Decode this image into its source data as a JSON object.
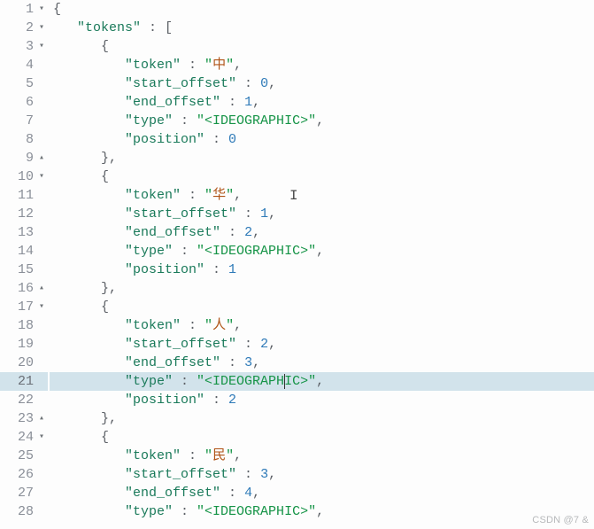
{
  "watermark": "CSDN @7 &",
  "highlighted_line": 21,
  "ibeam": {
    "line": 11,
    "text_before": "      \"token\" : \"华\",      "
  },
  "caret_line21_text_before": "      \"type\" : \"<IDEOGRAPH",
  "gutter": [
    {
      "n": "1",
      "fold": "down"
    },
    {
      "n": "2",
      "fold": "down"
    },
    {
      "n": "3",
      "fold": "down"
    },
    {
      "n": "4",
      "fold": ""
    },
    {
      "n": "5",
      "fold": ""
    },
    {
      "n": "6",
      "fold": ""
    },
    {
      "n": "7",
      "fold": ""
    },
    {
      "n": "8",
      "fold": ""
    },
    {
      "n": "9",
      "fold": "up"
    },
    {
      "n": "10",
      "fold": "down"
    },
    {
      "n": "11",
      "fold": ""
    },
    {
      "n": "12",
      "fold": ""
    },
    {
      "n": "13",
      "fold": ""
    },
    {
      "n": "14",
      "fold": ""
    },
    {
      "n": "15",
      "fold": ""
    },
    {
      "n": "16",
      "fold": "up"
    },
    {
      "n": "17",
      "fold": "down"
    },
    {
      "n": "18",
      "fold": ""
    },
    {
      "n": "19",
      "fold": ""
    },
    {
      "n": "20",
      "fold": ""
    },
    {
      "n": "21",
      "fold": ""
    },
    {
      "n": "22",
      "fold": ""
    },
    {
      "n": "23",
      "fold": "up"
    },
    {
      "n": "24",
      "fold": "down"
    },
    {
      "n": "25",
      "fold": ""
    },
    {
      "n": "26",
      "fold": ""
    },
    {
      "n": "27",
      "fold": ""
    },
    {
      "n": "28",
      "fold": ""
    }
  ],
  "lines": [
    {
      "i": 0,
      "t": [
        {
          "c": "p",
          "x": "{"
        }
      ]
    },
    {
      "i": 1,
      "t": [
        {
          "c": "k",
          "x": "\"tokens\""
        },
        {
          "c": "p",
          "x": " : ["
        }
      ]
    },
    {
      "i": 2,
      "t": [
        {
          "c": "p",
          "x": "{"
        }
      ]
    },
    {
      "i": 3,
      "t": [
        {
          "c": "k",
          "x": "\"token\""
        },
        {
          "c": "p",
          "x": " : "
        },
        {
          "c": "s",
          "x": "\""
        },
        {
          "c": "cj",
          "x": "中"
        },
        {
          "c": "s",
          "x": "\""
        },
        {
          "c": "p",
          "x": ","
        }
      ]
    },
    {
      "i": 3,
      "t": [
        {
          "c": "k",
          "x": "\"start_offset\""
        },
        {
          "c": "p",
          "x": " : "
        },
        {
          "c": "n",
          "x": "0"
        },
        {
          "c": "p",
          "x": ","
        }
      ]
    },
    {
      "i": 3,
      "t": [
        {
          "c": "k",
          "x": "\"end_offset\""
        },
        {
          "c": "p",
          "x": " : "
        },
        {
          "c": "n",
          "x": "1"
        },
        {
          "c": "p",
          "x": ","
        }
      ]
    },
    {
      "i": 3,
      "t": [
        {
          "c": "k",
          "x": "\"type\""
        },
        {
          "c": "p",
          "x": " : "
        },
        {
          "c": "s",
          "x": "\"<IDEOGRAPHIC>\""
        },
        {
          "c": "p",
          "x": ","
        }
      ]
    },
    {
      "i": 3,
      "t": [
        {
          "c": "k",
          "x": "\"position\""
        },
        {
          "c": "p",
          "x": " : "
        },
        {
          "c": "n",
          "x": "0"
        }
      ]
    },
    {
      "i": 2,
      "t": [
        {
          "c": "p",
          "x": "},"
        }
      ]
    },
    {
      "i": 2,
      "t": [
        {
          "c": "p",
          "x": "{"
        }
      ]
    },
    {
      "i": 3,
      "t": [
        {
          "c": "k",
          "x": "\"token\""
        },
        {
          "c": "p",
          "x": " : "
        },
        {
          "c": "s",
          "x": "\""
        },
        {
          "c": "cj",
          "x": "华"
        },
        {
          "c": "s",
          "x": "\""
        },
        {
          "c": "p",
          "x": ","
        }
      ]
    },
    {
      "i": 3,
      "t": [
        {
          "c": "k",
          "x": "\"start_offset\""
        },
        {
          "c": "p",
          "x": " : "
        },
        {
          "c": "n",
          "x": "1"
        },
        {
          "c": "p",
          "x": ","
        }
      ]
    },
    {
      "i": 3,
      "t": [
        {
          "c": "k",
          "x": "\"end_offset\""
        },
        {
          "c": "p",
          "x": " : "
        },
        {
          "c": "n",
          "x": "2"
        },
        {
          "c": "p",
          "x": ","
        }
      ]
    },
    {
      "i": 3,
      "t": [
        {
          "c": "k",
          "x": "\"type\""
        },
        {
          "c": "p",
          "x": " : "
        },
        {
          "c": "s",
          "x": "\"<IDEOGRAPHIC>\""
        },
        {
          "c": "p",
          "x": ","
        }
      ]
    },
    {
      "i": 3,
      "t": [
        {
          "c": "k",
          "x": "\"position\""
        },
        {
          "c": "p",
          "x": " : "
        },
        {
          "c": "n",
          "x": "1"
        }
      ]
    },
    {
      "i": 2,
      "t": [
        {
          "c": "p",
          "x": "},"
        }
      ]
    },
    {
      "i": 2,
      "t": [
        {
          "c": "p",
          "x": "{"
        }
      ]
    },
    {
      "i": 3,
      "t": [
        {
          "c": "k",
          "x": "\"token\""
        },
        {
          "c": "p",
          "x": " : "
        },
        {
          "c": "s",
          "x": "\""
        },
        {
          "c": "cj",
          "x": "人"
        },
        {
          "c": "s",
          "x": "\""
        },
        {
          "c": "p",
          "x": ","
        }
      ]
    },
    {
      "i": 3,
      "t": [
        {
          "c": "k",
          "x": "\"start_offset\""
        },
        {
          "c": "p",
          "x": " : "
        },
        {
          "c": "n",
          "x": "2"
        },
        {
          "c": "p",
          "x": ","
        }
      ]
    },
    {
      "i": 3,
      "t": [
        {
          "c": "k",
          "x": "\"end_offset\""
        },
        {
          "c": "p",
          "x": " : "
        },
        {
          "c": "n",
          "x": "3"
        },
        {
          "c": "p",
          "x": ","
        }
      ]
    },
    {
      "i": 3,
      "t": [
        {
          "c": "k",
          "x": "\"type\""
        },
        {
          "c": "p",
          "x": " : "
        },
        {
          "c": "s",
          "x": "\"<IDEOGRAPHIC>\""
        },
        {
          "c": "p",
          "x": ","
        }
      ]
    },
    {
      "i": 3,
      "t": [
        {
          "c": "k",
          "x": "\"position\""
        },
        {
          "c": "p",
          "x": " : "
        },
        {
          "c": "n",
          "x": "2"
        }
      ]
    },
    {
      "i": 2,
      "t": [
        {
          "c": "p",
          "x": "},"
        }
      ]
    },
    {
      "i": 2,
      "t": [
        {
          "c": "p",
          "x": "{"
        }
      ]
    },
    {
      "i": 3,
      "t": [
        {
          "c": "k",
          "x": "\"token\""
        },
        {
          "c": "p",
          "x": " : "
        },
        {
          "c": "s",
          "x": "\""
        },
        {
          "c": "cj",
          "x": "民"
        },
        {
          "c": "s",
          "x": "\""
        },
        {
          "c": "p",
          "x": ","
        }
      ]
    },
    {
      "i": 3,
      "t": [
        {
          "c": "k",
          "x": "\"start_offset\""
        },
        {
          "c": "p",
          "x": " : "
        },
        {
          "c": "n",
          "x": "3"
        },
        {
          "c": "p",
          "x": ","
        }
      ]
    },
    {
      "i": 3,
      "t": [
        {
          "c": "k",
          "x": "\"end_offset\""
        },
        {
          "c": "p",
          "x": " : "
        },
        {
          "c": "n",
          "x": "4"
        },
        {
          "c": "p",
          "x": ","
        }
      ]
    },
    {
      "i": 3,
      "t": [
        {
          "c": "k",
          "x": "\"type\""
        },
        {
          "c": "p",
          "x": " : "
        },
        {
          "c": "s",
          "x": "\"<IDEOGRAPHIC>\""
        },
        {
          "c": "p",
          "x": ","
        }
      ]
    }
  ]
}
